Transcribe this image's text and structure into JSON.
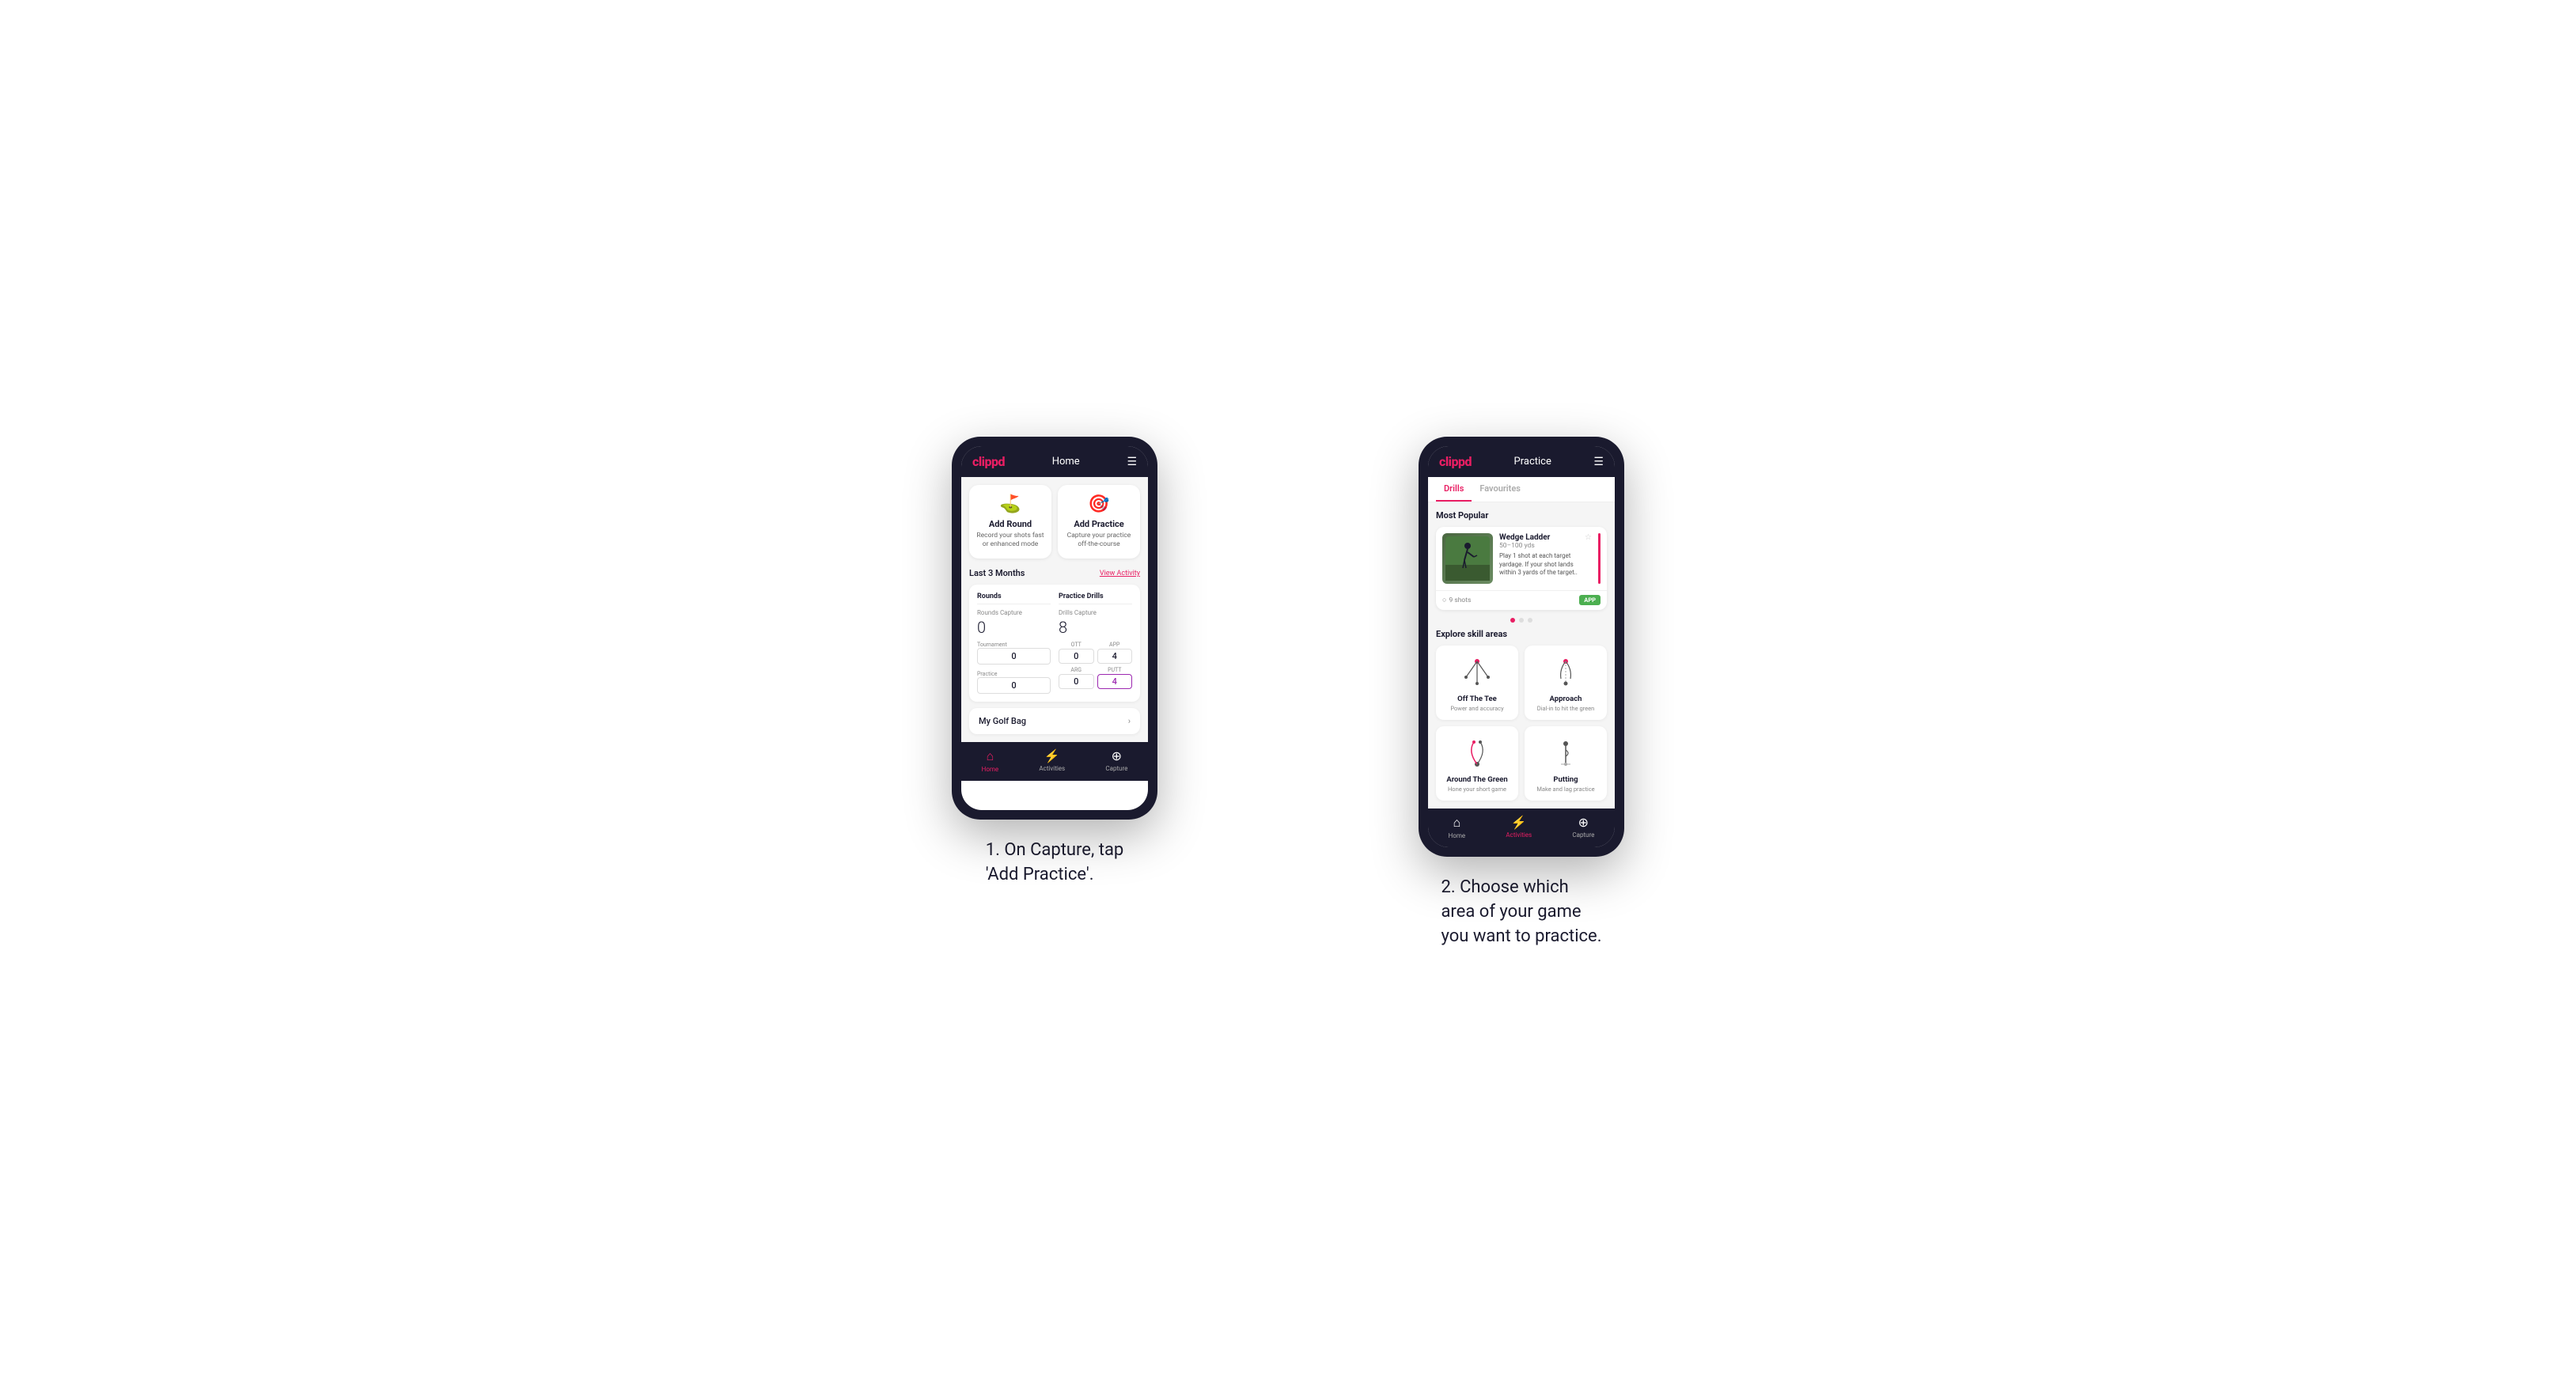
{
  "phone1": {
    "header": {
      "logo": "clippd",
      "title": "Home",
      "menu_icon": "☰"
    },
    "add_round": {
      "title": "Add Round",
      "desc": "Record your shots fast or enhanced mode",
      "icon": "⛳"
    },
    "add_practice": {
      "title": "Add Practice",
      "desc": "Capture your practice off-the-course",
      "icon": "🎯"
    },
    "last_3_months": "Last 3 Months",
    "view_activity": "View Activity",
    "rounds": {
      "title": "Rounds",
      "rounds_capture_label": "Rounds Capture",
      "rounds_capture_value": "0",
      "tournament_label": "Tournament",
      "tournament_value": "0",
      "practice_label": "Practice",
      "practice_value": "0"
    },
    "practice_drills": {
      "title": "Practice Drills",
      "drills_capture_label": "Drills Capture",
      "drills_capture_value": "8",
      "ott_label": "OTT",
      "ott_value": "0",
      "app_label": "APP",
      "app_value": "4",
      "arg_label": "ARG",
      "arg_value": "0",
      "putt_label": "PUTT",
      "putt_value": "4"
    },
    "golf_bag": "My Golf Bag",
    "nav": {
      "home": "Home",
      "activities": "Activities",
      "capture": "Capture"
    }
  },
  "phone2": {
    "header": {
      "logo": "clippd",
      "title": "Practice",
      "menu_icon": "☰"
    },
    "tabs": [
      "Drills",
      "Favourites"
    ],
    "active_tab": "Drills",
    "most_popular": "Most Popular",
    "featured_drill": {
      "name": "Wedge Ladder",
      "yards": "50–100 yds",
      "desc": "Play 1 shot at each target yardage. If your shot lands within 3 yards of the target..",
      "shots": "9 shots",
      "badge": "APP"
    },
    "explore_title": "Explore skill areas",
    "skills": [
      {
        "name": "Off The Tee",
        "desc": "Power and accuracy",
        "icon_type": "tee"
      },
      {
        "name": "Approach",
        "desc": "Dial-in to hit the green",
        "icon_type": "approach"
      },
      {
        "name": "Around The Green",
        "desc": "Hone your short game",
        "icon_type": "atg"
      },
      {
        "name": "Putting",
        "desc": "Make and lag practice",
        "icon_type": "putting"
      }
    ],
    "nav": {
      "home": "Home",
      "activities": "Activities",
      "capture": "Capture"
    }
  },
  "caption1": "1. On Capture, tap\n'Add Practice'.",
  "caption2": "2. Choose which\narea of your game\nyou want to practice."
}
